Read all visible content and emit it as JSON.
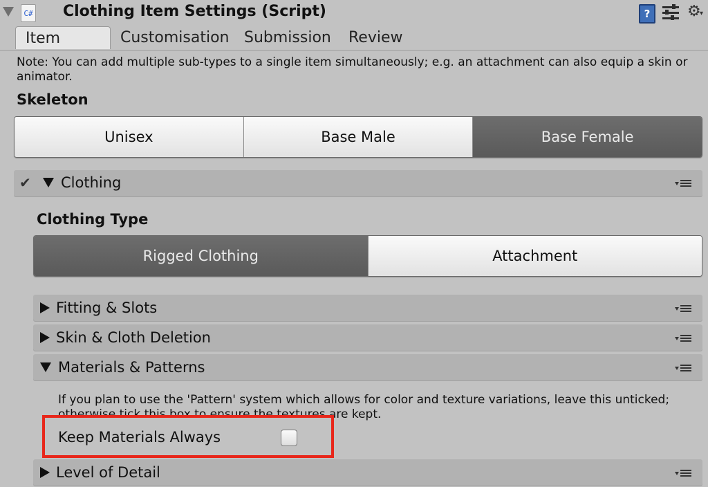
{
  "header": {
    "title": "Clothing Item Settings (Script)",
    "script_icon_text": "C#",
    "icons": [
      "fold-arrow-icon",
      "csharp-script-icon",
      "help-icon",
      "presets-icon",
      "gear-icon"
    ]
  },
  "tabs": [
    {
      "label": "Item",
      "active": true
    },
    {
      "label": "Customisation",
      "active": false
    },
    {
      "label": "Submission",
      "active": false
    },
    {
      "label": "Review",
      "active": false
    }
  ],
  "note": "Note: You can add multiple sub-types to a single item simultaneously; e.g. an attachment can also equip a skin or animator.",
  "skeleton": {
    "label": "Skeleton",
    "options": [
      "Unisex",
      "Base Male",
      "Base Female"
    ],
    "selected": "Base Female"
  },
  "clothing": {
    "label": "Clothing",
    "enabled": true,
    "expanded": true,
    "type_label": "Clothing Type",
    "type_options": [
      "Rigged Clothing",
      "Attachment"
    ],
    "type_selected": "Rigged Clothing",
    "sections": [
      {
        "label": "Fitting & Slots",
        "expanded": false
      },
      {
        "label": "Skin & Cloth Deletion",
        "expanded": false
      },
      {
        "label": "Materials & Patterns",
        "expanded": true
      },
      {
        "label": "Level of Detail",
        "expanded": false
      }
    ],
    "materials": {
      "info": "If you plan to use the 'Pattern' system which allows for color and texture variations, leave this unticked; otherwise tick this box to ensure the textures are kept.",
      "keep_label": "Keep Materials Always",
      "keep_checked": false
    }
  },
  "colors": {
    "background": "#c2c2c2",
    "selected_button": "#5f5f5f",
    "foldout": "#b2b2b2",
    "highlight": "#e8271b"
  }
}
